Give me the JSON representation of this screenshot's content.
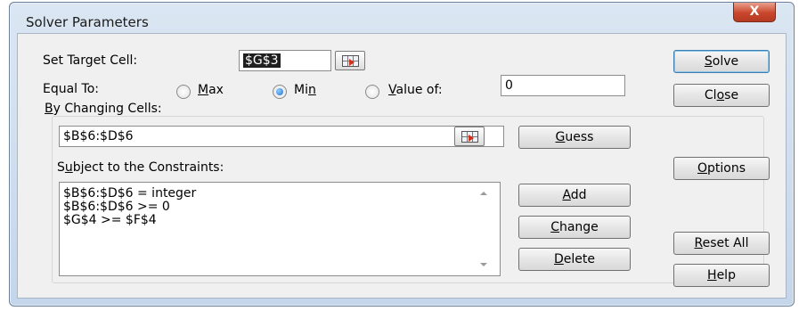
{
  "window": {
    "title": "Solver Parameters",
    "close_glyph": "X"
  },
  "target": {
    "label_pre": "Set Target Cell:",
    "value": "$G$3"
  },
  "equal_to": {
    "label": "Equal To:",
    "options": [
      {
        "label": "Max",
        "underline": "M",
        "rest": "ax",
        "checked": false
      },
      {
        "label": "Min",
        "pre": "Mi",
        "underline": "n",
        "checked": true
      },
      {
        "label": "Value of:",
        "underline": "V",
        "rest": "alue of:",
        "checked": false
      }
    ],
    "value_of": "0"
  },
  "changing": {
    "underline": "B",
    "rest": "y Changing Cells:",
    "value": "$B$6:$D$6"
  },
  "constraints": {
    "pre": "S",
    "underline": "u",
    "rest": "bject to the Constraints:",
    "items": [
      "$B$6:$D$6 = integer",
      "$B$6:$D$6 >= 0",
      "$G$4 >= $F$4"
    ]
  },
  "buttons": {
    "guess": {
      "underline": "G",
      "rest": "uess"
    },
    "add": {
      "underline": "A",
      "rest": "dd"
    },
    "change": {
      "underline": "C",
      "rest": "hange"
    },
    "delete": {
      "underline": "D",
      "rest": "elete"
    },
    "solve": {
      "underline": "S",
      "rest": "olve"
    },
    "close": {
      "pre": "Cl",
      "underline": "o",
      "rest": "se"
    },
    "options": {
      "underline": "O",
      "rest": "ptions"
    },
    "reset_all": {
      "underline": "R",
      "rest": "eset All"
    },
    "help": {
      "underline": "H",
      "rest": "elp"
    }
  },
  "icons": {
    "reference": "range-select-icon",
    "close": "close-icon",
    "scroll_up": "scroll-up-arrow-icon",
    "scroll_down": "scroll-down-arrow-icon"
  }
}
